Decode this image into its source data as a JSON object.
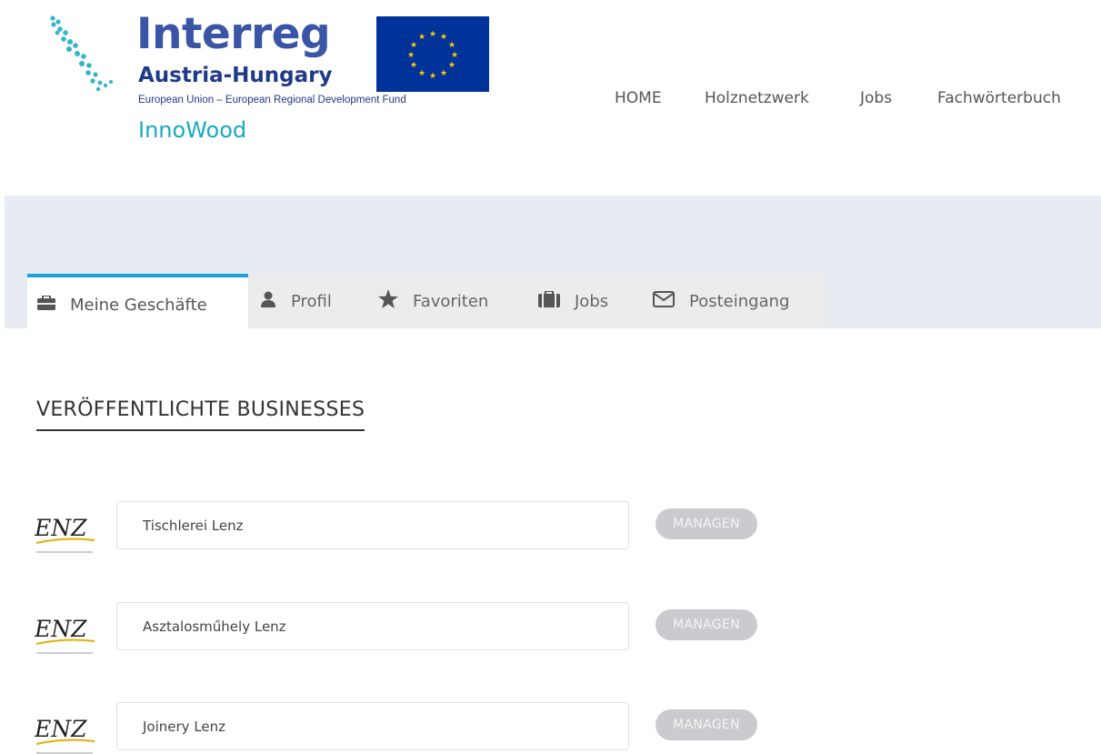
{
  "brand": {
    "name": "Interreg",
    "region": "Austria-Hungary",
    "fund": "European Union – European Regional Development Fund",
    "project": "InnoWood"
  },
  "nav": {
    "items": [
      "HOME",
      "Holznetzwerk",
      "Jobs",
      "Fachwörterbuch"
    ]
  },
  "tabs": [
    {
      "label": "Meine Geschäfte",
      "icon": "briefcase-icon",
      "active": true
    },
    {
      "label": "Profil",
      "icon": "user-icon",
      "active": false
    },
    {
      "label": "Favoriten",
      "icon": "star-icon",
      "active": false
    },
    {
      "label": "Jobs",
      "icon": "suitcase-icon",
      "active": false
    },
    {
      "label": "Posteingang",
      "icon": "envelope-icon",
      "active": false
    }
  ],
  "section": {
    "title": "VERÖFFENTLICHTE BUSINESSES"
  },
  "businesses": [
    {
      "name": "Tischlerei Lenz",
      "logo_text": "ENZ",
      "action": "MANAGEN"
    },
    {
      "name": "Asztalosműhely Lenz",
      "logo_text": "ENZ",
      "action": "MANAGEN"
    },
    {
      "name": "Joinery Lenz",
      "logo_text": "ENZ",
      "action": "MANAGEN"
    }
  ],
  "colors": {
    "brand_blue": "#3a55a6",
    "accent_cyan": "#1aa3d9",
    "banner_bg": "#e6ecf2",
    "eu_blue": "#003399",
    "eu_star": "#ffcc00"
  }
}
